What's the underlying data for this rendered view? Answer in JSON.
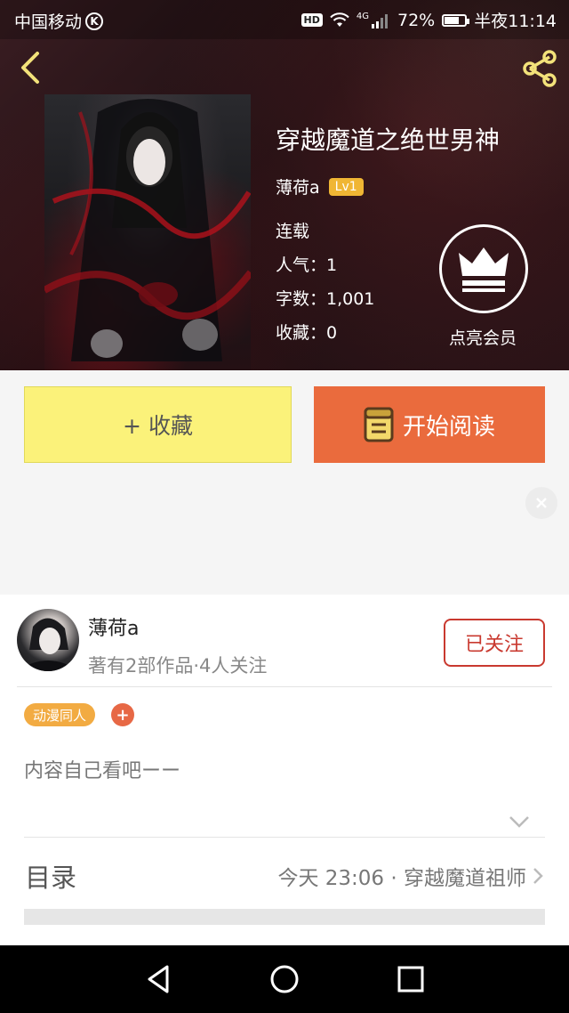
{
  "status_bar": {
    "carrier": "中国移动",
    "k_badge": "K",
    "hd": "HD",
    "network": "4G",
    "battery_pct": "72%",
    "battery_level": 0.72,
    "time": "半夜11:14"
  },
  "book": {
    "title": "穿越魔道之绝世男神",
    "author": "薄荷a",
    "level": "Lv1",
    "status": "连载",
    "popularity": "人气：1",
    "word_count": "字数：1,001",
    "favorites": "收藏：0",
    "vip_label": "点亮会员"
  },
  "actions": {
    "favorite_label": "+ 收藏",
    "read_label": "开始阅读"
  },
  "author_card": {
    "name": "薄荷a",
    "stats": "著有2部作品·4人关注",
    "follow_label": "已关注",
    "tag": "动漫同人",
    "tag_add": "+",
    "intro": "内容自己看吧ーー"
  },
  "toc": {
    "label": "目录",
    "latest": "今天 23:06 · 穿越魔道祖师"
  },
  "colors": {
    "favorite_bg": "#fbf27a",
    "read_bg": "#ea6b3d",
    "follow_border": "#c9392f",
    "tag_bg": "#f2ab42",
    "level_badge": "#f0b634"
  }
}
